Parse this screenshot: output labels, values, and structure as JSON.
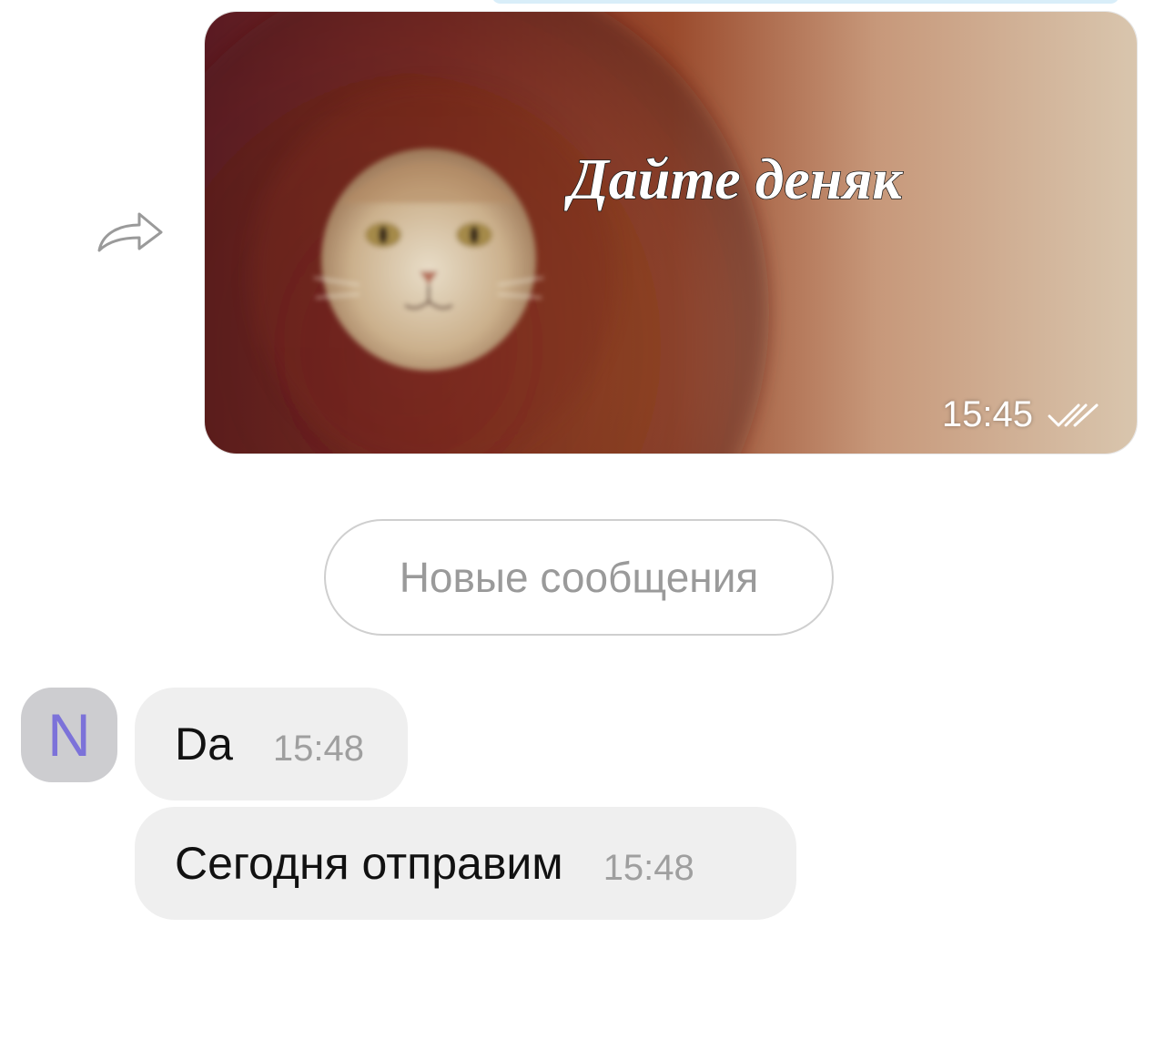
{
  "icons": {
    "forward": "forward-arrow-icon",
    "read_status": "double-check-icon"
  },
  "photo_message": {
    "caption": "Дайте деняк",
    "time": "15:45"
  },
  "divider": {
    "label": "Новые сообщения"
  },
  "sender": {
    "avatar_initial": "N"
  },
  "messages": [
    {
      "text": "Da",
      "time": "15:48"
    },
    {
      "text": "Сегодня отправим",
      "time": "15:48"
    }
  ],
  "colors": {
    "bubble_incoming": "#efefef",
    "avatar_bg": "#cdcdd0",
    "avatar_letter": "#7c72d9",
    "divider_border": "#cfcfcf",
    "divider_text": "#9a9a9a",
    "time_text": "#9f9f9f"
  }
}
